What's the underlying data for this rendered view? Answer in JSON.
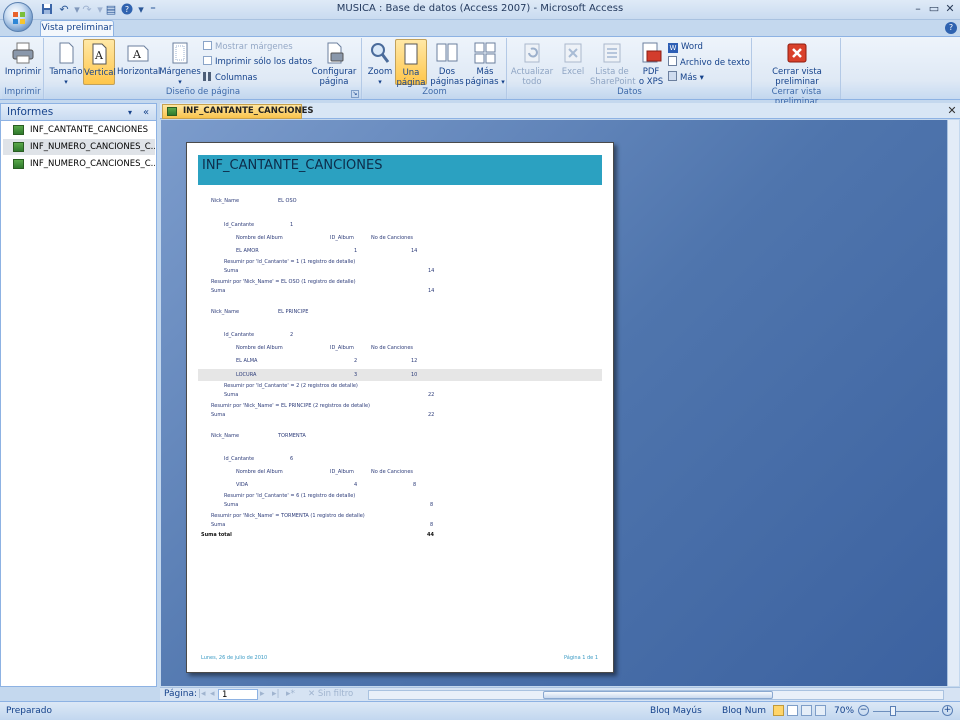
{
  "window": {
    "title": "MUSICA : Base de datos (Access 2007) - Microsoft Access"
  },
  "ribbon": {
    "tab": "Vista preliminar",
    "groups": {
      "imprimir": "Imprimir",
      "diseno": "Diseño de página",
      "zoom": "Zoom",
      "datos": "Datos",
      "cerrar": "Cerrar vista preliminar"
    },
    "buttons": {
      "imprimir": "Imprimir",
      "tamano": "Tamaño",
      "vertical": "Vertical",
      "horizontal": "Horizontal",
      "margenes": "Márgenes",
      "mostrar_margenes": "Mostrar márgenes",
      "imprimir_solo": "Imprimir sólo los datos",
      "columnas": "Columnas",
      "configurar_1": "Configurar",
      "configurar_2": "página",
      "zoom": "Zoom",
      "una_1": "Una",
      "una_2": "página",
      "dos_1": "Dos",
      "dos_2": "páginas",
      "mas_1": "Más",
      "mas_2": "páginas",
      "actualizar_1": "Actualizar",
      "actualizar_2": "todo",
      "excel": "Excel",
      "sharepoint_1": "Lista de",
      "sharepoint_2": "SharePoint",
      "pdf_1": "PDF",
      "pdf_2": "o XPS",
      "word": "Word",
      "archivo_texto": "Archivo de texto",
      "mas": "Más",
      "cerrar_1": "Cerrar vista",
      "cerrar_2": "preliminar"
    }
  },
  "nav_pane": {
    "header": "Informes",
    "items": [
      "INF_CANTANTE_CANCIONES",
      "INF_NUMERO_CANCIONES_C...",
      "INF_NUMERO_CANCIONES_C..."
    ]
  },
  "document_tab": "INF_CANTANTE_CANCIONES",
  "report": {
    "title": "INF_CANTANTE_CANCIONES",
    "labels": {
      "nick": "Nick_Name",
      "id_cantante": "Id_Cantante",
      "nombre_album": "Nombre del Album",
      "id_album": "ID_Album",
      "no_canciones": "No de Canciones",
      "suma": "Suma",
      "suma_total": "Suma total"
    },
    "groups": [
      {
        "nick": "EL OSO",
        "id": "1",
        "albums": [
          {
            "name": "EL AMOR",
            "id": "1",
            "count": "14"
          }
        ],
        "resumen_id": "Resumir por 'Id_Cantante' = 1 (1 registro de detalle)",
        "suma_id": "14",
        "resumen_nick": "Resumir por 'Nick_Name' = EL OSO (1 registro de detalle)",
        "suma_nick": "14"
      },
      {
        "nick": "EL PRINCIPE",
        "id": "2",
        "albums": [
          {
            "name": "EL ALMA",
            "id": "2",
            "count": "12"
          },
          {
            "name": "LOCURA",
            "id": "3",
            "count": "10"
          }
        ],
        "resumen_id": "Resumir por 'Id_Cantante' = 2 (2 registros de detalle)",
        "suma_id": "22",
        "resumen_nick": "Resumir por 'Nick_Name' = EL PRINCIPE (2 registros de detalle)",
        "suma_nick": "22"
      },
      {
        "nick": "TORMENTA",
        "id": "6",
        "albums": [
          {
            "name": "VIDA",
            "id": "4",
            "count": "8"
          }
        ],
        "resumen_id": "Resumir por 'Id_Cantante' = 6 (1 registro de detalle)",
        "suma_id": "8",
        "resumen_nick": "Resumir por 'Nick_Name' = TORMENTA (1 registro de detalle)",
        "suma_nick": "8"
      }
    ],
    "suma_total": "44",
    "footer_date": "Lunes, 26 de julio de 2010",
    "footer_page": "Página 1 de 1"
  },
  "record_nav": {
    "label": "Página:",
    "value": "1",
    "filter": "Sin filtro"
  },
  "status": {
    "left": "Preparado",
    "caps": "Bloq Mayús",
    "num": "Bloq Num",
    "zoom": "70%"
  },
  "colors": {
    "title_bar": "#2ba1c1",
    "active_button": "#ffc64a",
    "preview_bg": "#4f75ad"
  }
}
